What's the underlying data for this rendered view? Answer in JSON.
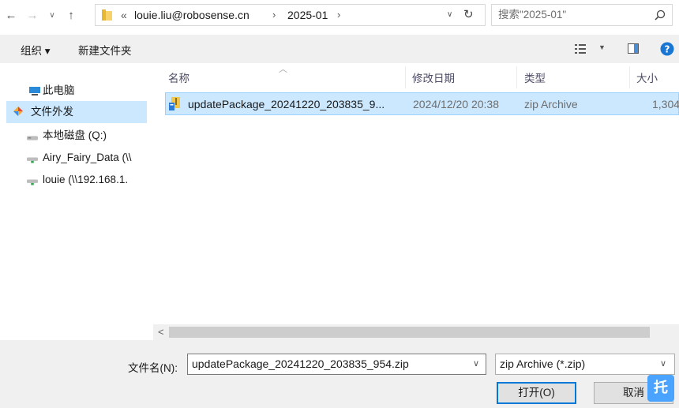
{
  "address_bar": {
    "overflow": "«",
    "segments": [
      "louie.liu@robosense.cn",
      "2025-01"
    ],
    "separator": "›"
  },
  "search": {
    "placeholder": "搜索\"2025-01\""
  },
  "toolbar": {
    "organize_label": "组织 ▾",
    "new_folder_label": "新建文件夹"
  },
  "nav_pane": {
    "items": [
      {
        "label": "此电脑",
        "icon": "computer-icon"
      },
      {
        "label": "文件外发",
        "icon": "file-transfer-icon"
      },
      {
        "label": "本地磁盘 (Q:)",
        "icon": "drive-icon"
      },
      {
        "label": "Airy_Fairy_Data (\\\\",
        "icon": "network-drive-icon"
      },
      {
        "label": "louie (\\\\192.168.1.",
        "icon": "network-drive-icon"
      }
    ]
  },
  "file_list": {
    "columns": [
      "名称",
      "修改日期",
      "类型",
      "大小"
    ],
    "rows": [
      {
        "name": "updatePackage_20241220_203835_9...",
        "modified": "2024/12/20 20:38",
        "type": "zip Archive",
        "size": "1,304"
      }
    ]
  },
  "footer": {
    "filename_label": "文件名(N):",
    "filename_value": "updatePackage_20241220_203835_954.zip",
    "filter_value": "zip Archive (*.zip)",
    "open_label": "打开(O)",
    "cancel_label": "取消",
    "badge": "托"
  },
  "colors": {
    "selection": "#cce8ff",
    "selection_border": "#99d1ff",
    "accent": "#0078d7"
  }
}
